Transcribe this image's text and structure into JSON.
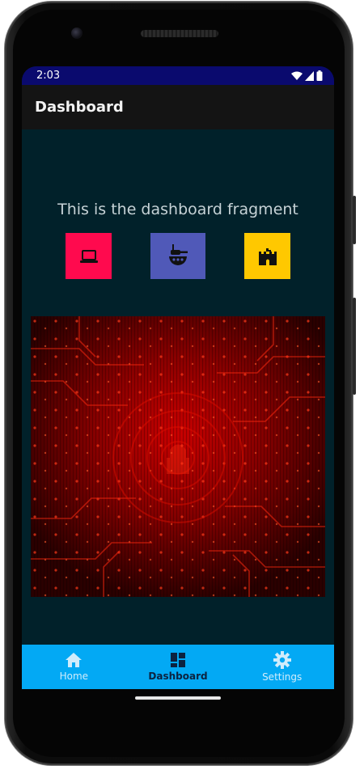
{
  "status_bar": {
    "time": "2:03"
  },
  "app_bar": {
    "title": "Dashboard"
  },
  "main": {
    "fragment_text": "This is the dashboard fragment",
    "tiles": [
      {
        "name": "laptop",
        "icon": "laptop-icon",
        "color": "#ff0a4e"
      },
      {
        "name": "tank",
        "icon": "tank-icon",
        "color": "#5059b8"
      },
      {
        "name": "castle",
        "icon": "castle-icon",
        "color": "#ffc800"
      }
    ],
    "hero_image": {
      "icon": "circuit-board-image",
      "color": "#c40000"
    }
  },
  "bottom_nav": {
    "items": [
      {
        "label": "Home",
        "icon": "home-icon"
      },
      {
        "label": "Dashboard",
        "icon": "dashboard-icon",
        "active": true
      },
      {
        "label": "Settings",
        "icon": "gear-icon"
      }
    ],
    "background": "#03a9f4"
  },
  "colors": {
    "status_bar": "#0a0a6e",
    "app_bar": "#141414",
    "content_background": "#01212a"
  }
}
